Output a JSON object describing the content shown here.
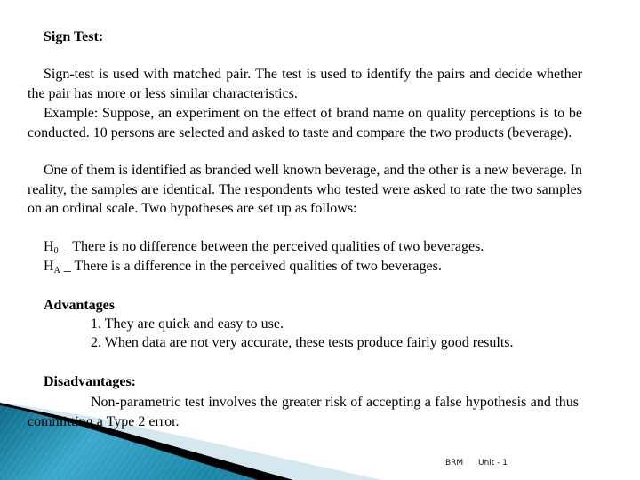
{
  "slide": {
    "title": "Sign Test:",
    "paragraphs": [
      "Sign-test is used with matched pair. The test is used to identify the pairs and decide whether the pair has more or less similar characteristics.",
      "Example: Suppose, an experiment on the effect of brand name on quality perceptions is to be conducted. 10 persons are selected and asked to taste and compare the two products (beverage).",
      "One of them is identified as branded well known beverage, and the other is a new beverage. In reality, the samples are identical. The respondents who tested were asked to rate the two samples on an ordinal scale. Two hypotheses are set up as follows:"
    ],
    "hypotheses": [
      {
        "symbol": "H",
        "subscript": "0",
        "separator": " _ ",
        "text": "There is no difference between the perceived qualities of two beverages."
      },
      {
        "symbol": "H",
        "subscript": "A",
        "separator": " _ ",
        "text": "There is a difference in the perceived qualities of two beverages."
      }
    ],
    "advantages": {
      "heading": "Advantages",
      "items": [
        "1. They are quick and easy to use.",
        "2. When data are not very accurate, these tests produce fairly good results."
      ]
    },
    "disadvantages": {
      "heading": "Disadvantages:",
      "text": "Non-parametric test involves the greater risk of accepting a false hypothesis and thus committing a Type 2 error."
    },
    "footer": {
      "left": "BRM",
      "right": "Unit - 1"
    }
  },
  "theme": {
    "background": "#ffffff",
    "text": "#000000",
    "accent_dark": "#0e6f8c",
    "accent_mid": "#2a9cc0",
    "accent_light": "#d5e7ef",
    "band": "#000000"
  }
}
